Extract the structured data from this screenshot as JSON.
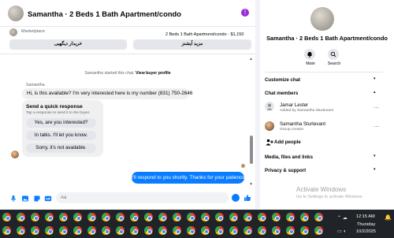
{
  "chat": {
    "title": "Samantha · 2 Beds 1 Bath Apartment/condo",
    "marketplace_label": "Marketplace",
    "listing_summary": "2 Beds 1 Bath Apartment/condo · $1,150",
    "buttons": {
      "left": "خریدار دیگهیی",
      "right": "مزید آیشنز"
    },
    "system_message": "Samantha started this chat.",
    "system_link": "View buyer profile",
    "sender_name": "Samantha",
    "incoming_message": "Hi, is this available? I'm very interested here is my number (831) 750-2646",
    "quick_response": {
      "title": "Send a quick response",
      "subtitle": "Tap a response to send it to the buyer.",
      "options": [
        "Yes, are you interested?",
        "In talks. I'll let you know.",
        "Sorry, it's not available."
      ]
    },
    "outgoing_message": "I'll respond to you shortly. Thanks for your patience",
    "input_placeholder": "Aa"
  },
  "panel": {
    "title": "Samantha · 2 Beds 1 Bath Apartment/condo",
    "actions": {
      "mute": "Mute",
      "search": "Search"
    },
    "sections": {
      "customize": "Customize chat",
      "members": "Chat members",
      "media": "Media, files and links",
      "privacy": "Privacy & support"
    },
    "members": [
      {
        "name": "Jamar Lester",
        "sub": "Added by Samantha Sturtevant"
      },
      {
        "name": "Samantha Sturtevant",
        "sub": "Group creator"
      }
    ],
    "add_people": "Add people"
  },
  "watermark": {
    "line1": "Activate Windows",
    "line2": "Go to Settings to activate Windows."
  },
  "taskbar": {
    "time": "12:15 AM",
    "day": "Thursday",
    "date": "10/2/2025"
  },
  "colors": {
    "accent": "#0a7cff",
    "taskbar": "#202428",
    "bubble_in": "#f0f0f0"
  }
}
